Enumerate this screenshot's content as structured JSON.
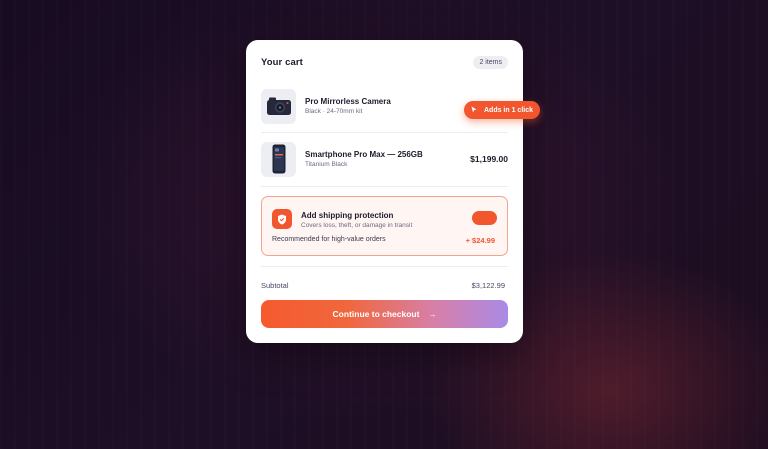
{
  "cart": {
    "title": "Your cart",
    "count_badge": "2 items"
  },
  "items": [
    {
      "name": "Pro Mirrorless Camera",
      "variant": "Black · 24-70mm kit",
      "price": "",
      "icon": "camera-icon"
    },
    {
      "name": "Smartphone Pro Max — 256GB",
      "variant": "Titanium Black",
      "price": "$1,199.00",
      "icon": "smartphone-icon"
    }
  ],
  "promo": {
    "label": "Adds in 1 click",
    "icon": "cursor-icon"
  },
  "protection": {
    "title": "Add shipping protection",
    "subtitle": "Covers loss, theft, or damage in transit",
    "note": "Recommended for high-value orders",
    "price": "+ $24.99",
    "icon": "shield-icon",
    "enabled": true
  },
  "summary": {
    "subtotal_label": "Subtotal",
    "subtotal_value": "$3,122.99"
  },
  "checkout": {
    "label": "Continue to checkout",
    "arrow": "→"
  },
  "colors": {
    "accent": "#f2562e",
    "gradient_end": "#a98ae6",
    "background": "#1d0f26"
  }
}
